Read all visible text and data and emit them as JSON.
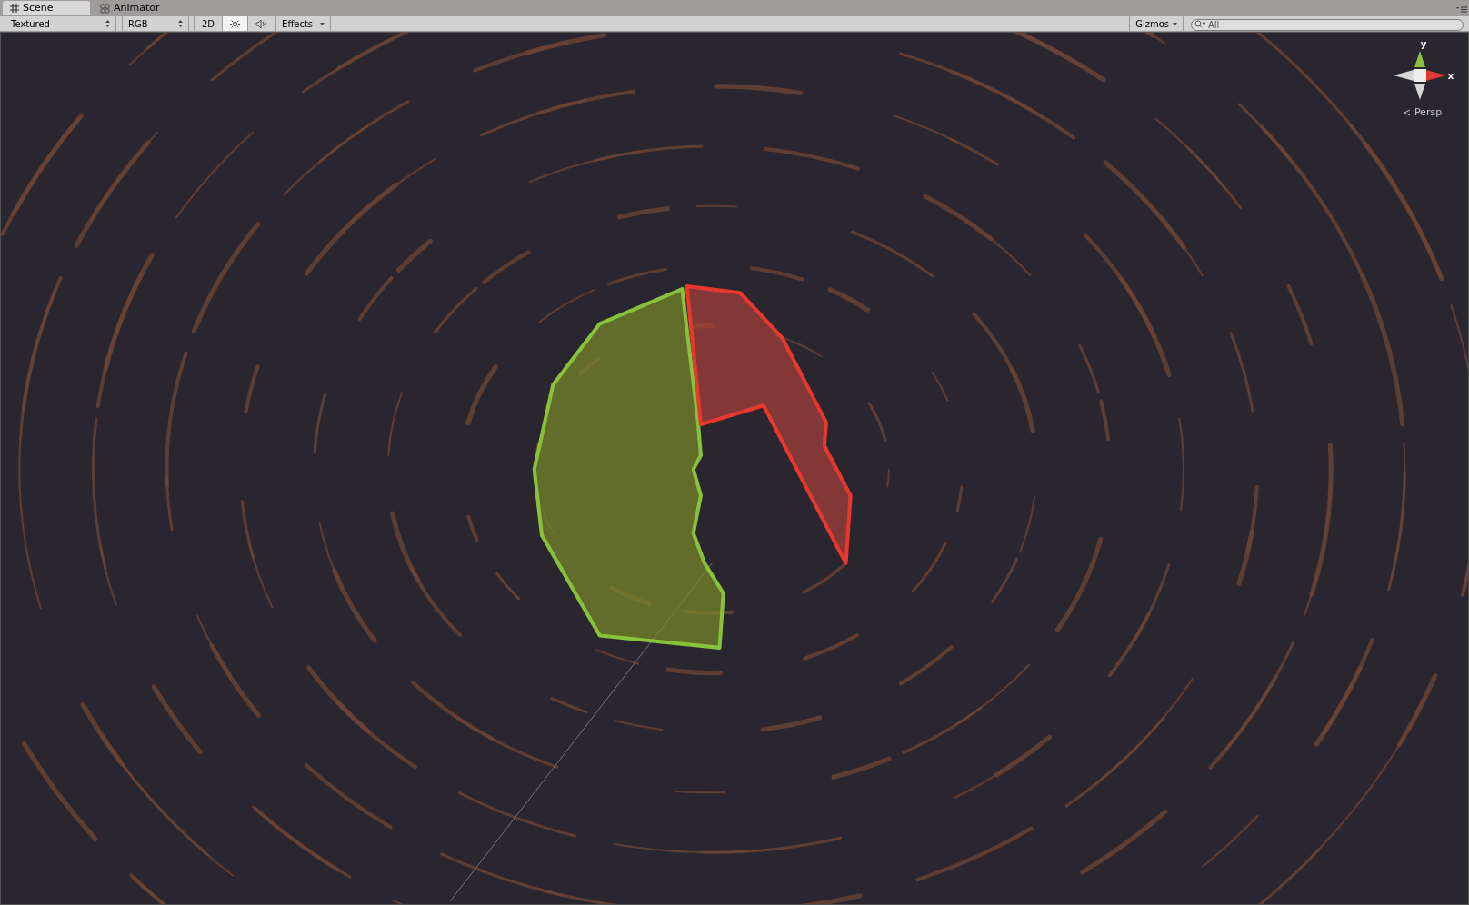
{
  "tabs": [
    {
      "label": "Scene",
      "kind": "scene",
      "selected": true
    },
    {
      "label": "Animator",
      "kind": "animator",
      "selected": false
    }
  ],
  "toolbar": {
    "draw_mode": "Textured",
    "render_mode": "RGB",
    "mode_2d": {
      "label": "2D",
      "selected": false
    },
    "lighting": {
      "selected": true
    },
    "audio": {
      "selected": false
    },
    "effects": "Effects",
    "gizmos": "Gizmos",
    "search": {
      "placeholder": "All"
    }
  },
  "gizmo": {
    "y_label": "y",
    "x_label": "x",
    "projection": "Persp"
  }
}
